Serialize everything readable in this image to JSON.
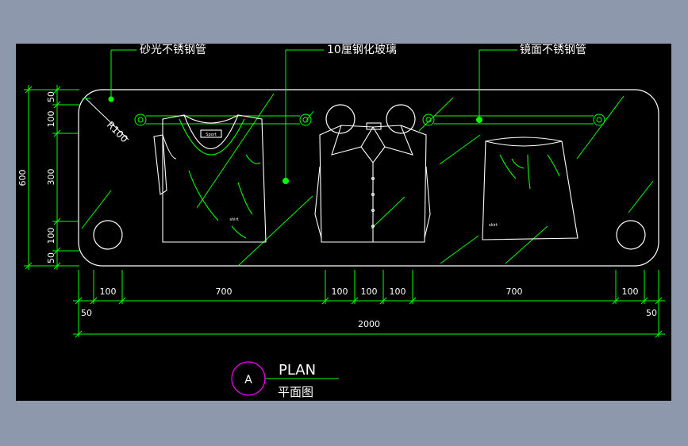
{
  "callouts": {
    "left": "砂光不锈钢管",
    "middle": "10厘钢化玻璃",
    "right": "镜面不锈钢管"
  },
  "radius_label": "R100",
  "vertical_dims": {
    "total": "600",
    "segments": [
      "50",
      "100",
      "300",
      "100",
      "50"
    ]
  },
  "horizontal_dims": {
    "row1": [
      "100",
      "700",
      "100",
      "100",
      "100",
      "700",
      "100"
    ],
    "row2_left": "50",
    "row2_right": "50",
    "total": "2000"
  },
  "garment_tags": {
    "tshirt_neck": "Sport",
    "tshirt_body": "shirt",
    "skirt": "skirt"
  },
  "title_block": {
    "marker": "A",
    "title": "PLAN",
    "subtitle": "平面图"
  },
  "colors": {
    "background": "#8e98ad",
    "drawing": "#000000",
    "outline": "#ffffff",
    "accent": "#00ff00",
    "marker": "#ff00ff"
  }
}
